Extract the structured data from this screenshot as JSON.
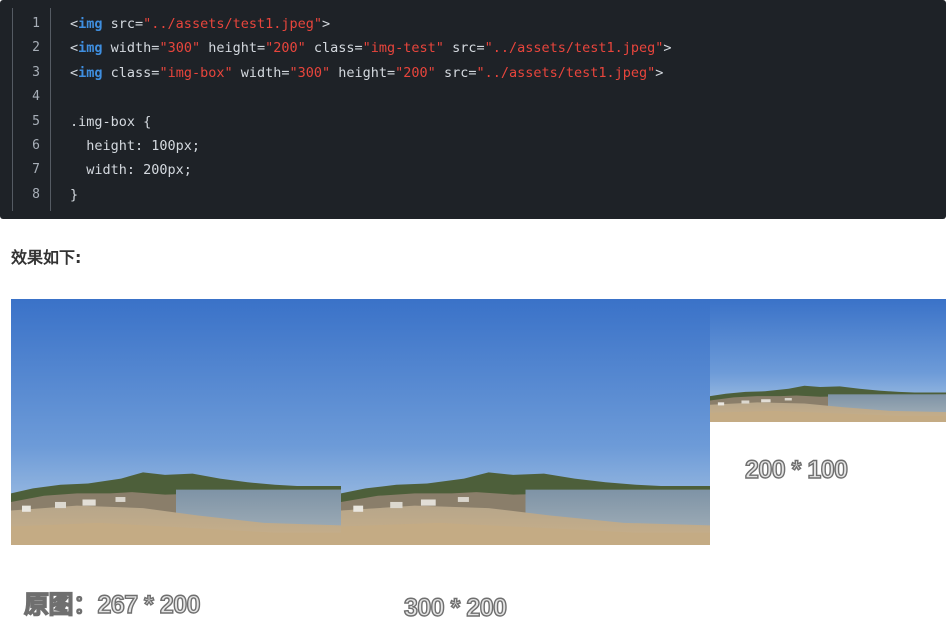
{
  "code": {
    "line_numbers": [
      "1",
      "2",
      "3",
      "4",
      "5",
      "6",
      "7",
      "8"
    ],
    "lines": [
      [
        {
          "t": "<",
          "c": "pun"
        },
        {
          "t": "img",
          "c": "tag"
        },
        {
          "t": " src=",
          "c": "pun"
        },
        {
          "t": "\"../assets/test1.jpeg\"",
          "c": "str"
        },
        {
          "t": ">",
          "c": "pun"
        }
      ],
      [
        {
          "t": "<",
          "c": "pun"
        },
        {
          "t": "img",
          "c": "tag"
        },
        {
          "t": " width=",
          "c": "pun"
        },
        {
          "t": "\"300\"",
          "c": "str"
        },
        {
          "t": " height=",
          "c": "pun"
        },
        {
          "t": "\"200\"",
          "c": "str"
        },
        {
          "t": " class=",
          "c": "pun"
        },
        {
          "t": "\"img-test\"",
          "c": "str"
        },
        {
          "t": " src=",
          "c": "pun"
        },
        {
          "t": "\"../assets/test1.jpeg\"",
          "c": "str"
        },
        {
          "t": ">",
          "c": "pun"
        }
      ],
      [
        {
          "t": "<",
          "c": "pun"
        },
        {
          "t": "img",
          "c": "tag"
        },
        {
          "t": " class=",
          "c": "pun"
        },
        {
          "t": "\"img-box\"",
          "c": "str"
        },
        {
          "t": " width=",
          "c": "pun"
        },
        {
          "t": "\"300\"",
          "c": "str"
        },
        {
          "t": " height=",
          "c": "pun"
        },
        {
          "t": "\"200\"",
          "c": "str"
        },
        {
          "t": " src=",
          "c": "pun"
        },
        {
          "t": "\"../assets/test1.jpeg\"",
          "c": "str"
        },
        {
          "t": ">",
          "c": "pun"
        }
      ],
      [],
      [
        {
          "t": ".img-box {",
          "c": "pun"
        }
      ],
      [
        {
          "t": "  height: 100px;",
          "c": "pun"
        }
      ],
      [
        {
          "t": "  width: 200px;",
          "c": "pun"
        }
      ],
      [
        {
          "t": "}",
          "c": "pun"
        }
      ]
    ]
  },
  "heading": "效果如下:",
  "captions": {
    "original": "原图：267 * 200",
    "sized": "300 * 200",
    "box": "200 * 100"
  },
  "colors": {
    "code_bg": "#1e2227",
    "tag": "#3f8fe0",
    "string": "#e8453c",
    "text": "#d4d9df"
  }
}
